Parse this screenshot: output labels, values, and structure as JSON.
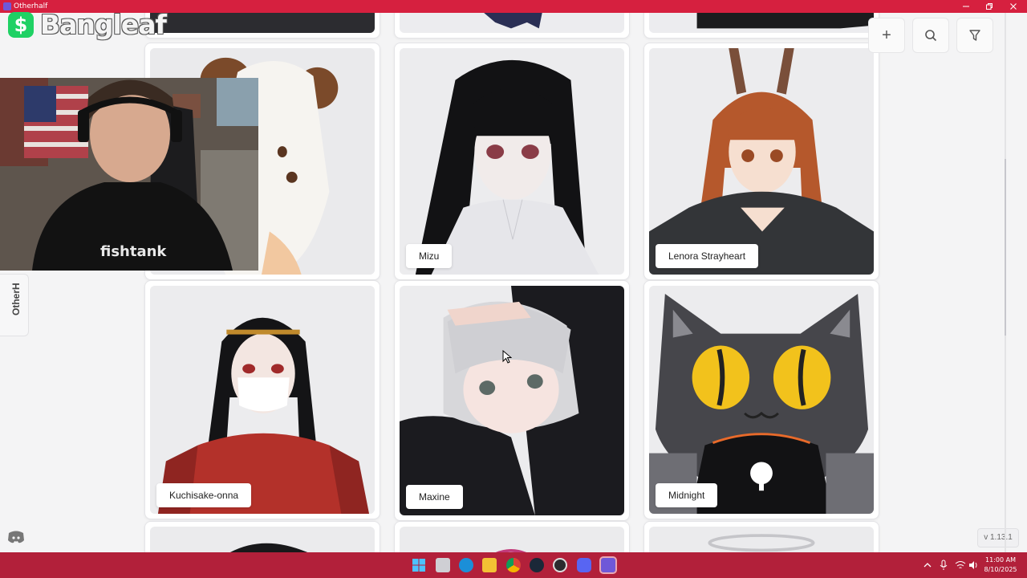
{
  "window": {
    "title": "Otherhalf"
  },
  "overlay": {
    "streamer_name": "Bangleaf",
    "cash_symbol": "$"
  },
  "sidebar": {
    "vertical_label": "OtherH"
  },
  "toolbar": {
    "add_icon": "+",
    "search_icon": "search-icon",
    "filter_icon": "filter-icon"
  },
  "version": "v 1.13.1",
  "characters": [
    {
      "name": ""
    },
    {
      "name": "Mizu"
    },
    {
      "name": "Lenora Strayheart"
    },
    {
      "name": "Kuchisake-onna"
    },
    {
      "name": "Maxine"
    },
    {
      "name": "Midnight"
    }
  ],
  "webcam": {
    "shirt_text": "fishtank"
  },
  "taskbar": {
    "time": "11:00 AM",
    "date": "8/10/2025"
  },
  "colors": {
    "titlebar": "#d6203f",
    "taskbar": "#b2203a",
    "accent": "#6f58d8"
  }
}
